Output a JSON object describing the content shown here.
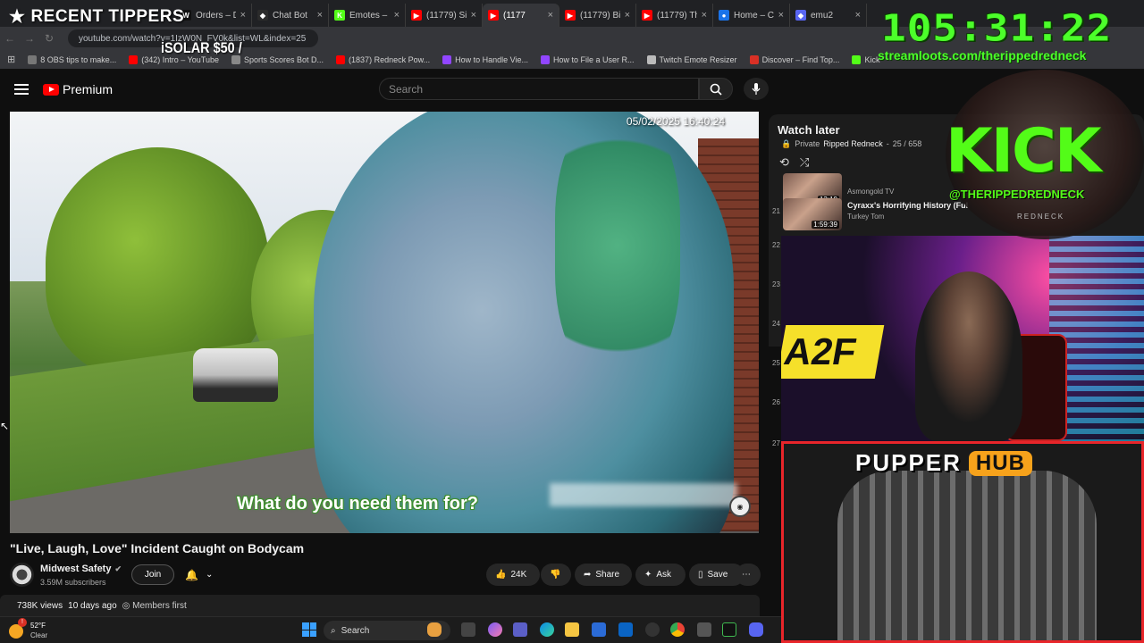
{
  "overlay": {
    "tippers_title": "RECENT TIPPERS",
    "tip_line": "iSOLAR $50 /",
    "timer": "105:31:22",
    "streamloots": "streamloots.com/therippedredneck",
    "kick_logo": "KICK",
    "kick_handle": "@THERIPPEDREDNECK",
    "kick_sub": "REDNECK",
    "pupper": "PUPPER",
    "hub": "HUB"
  },
  "browser": {
    "tabs": [
      {
        "label": "Orders – D",
        "color": "#111111",
        "glyph": "W"
      },
      {
        "label": "Chat Bot",
        "color": "#2b2b2b",
        "glyph": "◆"
      },
      {
        "label": "Emotes – ",
        "color": "#53fc18",
        "glyph": "K"
      },
      {
        "label": "(11779) Si",
        "color": "#ff0000",
        "glyph": "▶"
      },
      {
        "label": "(1177",
        "color": "#ff0000",
        "glyph": "▶"
      },
      {
        "label": "(11779) Bi",
        "color": "#ff0000",
        "glyph": "▶"
      },
      {
        "label": "(11779) Th",
        "color": "#ff0000",
        "glyph": "▶"
      },
      {
        "label": "Home – C",
        "color": "#1a73e8",
        "glyph": "●"
      },
      {
        "label": "emu2",
        "color": "#5865f2",
        "glyph": "◆"
      }
    ],
    "url": "youtube.com/watch?v=1IzW0N_FV0k&list=WL&index=25",
    "bookmarks": [
      {
        "label": "8 OBS tips to make...",
        "color": "#777777"
      },
      {
        "label": "(342) Intro – YouTube",
        "color": "#ff0000"
      },
      {
        "label": "Sports Scores Bot D...",
        "color": "#888888"
      },
      {
        "label": "(1837) Redneck Pow...",
        "color": "#ff0000"
      },
      {
        "label": "How to Handle Vie...",
        "color": "#9146ff"
      },
      {
        "label": "How to File a User R...",
        "color": "#9146ff"
      },
      {
        "label": "Twitch Emote Resizer",
        "color": "#bbbbbb"
      },
      {
        "label": "Discover – Find Top...",
        "color": "#d93025"
      },
      {
        "label": "Kick",
        "color": "#53fc18"
      }
    ]
  },
  "youtube": {
    "brand": "Premium",
    "search_placeholder": "Search",
    "video": {
      "timestamp": "05/02/2025 16:40:24",
      "subtitle": "What do you need them for?",
      "title": "\"Live, Laugh, Love\" Incident Caught on Bodycam"
    },
    "channel": {
      "name": "Midwest Safety",
      "subscribers": "3.59M subscribers",
      "join_label": "Join"
    },
    "actions": {
      "likes": "24K",
      "share": "Share",
      "ask": "Ask",
      "save": "Save"
    },
    "meta": {
      "views": "738K views",
      "age": "10 days ago",
      "members": "Members first"
    },
    "playlist": {
      "title": "Watch later",
      "privacy": "Private",
      "owner": "Ripped Redneck",
      "position": "25 / 658",
      "items": [
        {
          "index": "",
          "duration": "13:19",
          "title": "",
          "channel": "Asmongold TV"
        },
        {
          "index": "21",
          "duration": "1:59:39",
          "title": "Cyraxx's Horrifying History (Ful",
          "channel": "Turkey Tom"
        }
      ],
      "side_numbers": [
        "22",
        "23",
        "24",
        "25",
        "26",
        "27"
      ]
    }
  },
  "taskbar": {
    "temperature": "52°F",
    "condition": "Clear",
    "badge": "!",
    "search_label": "Search"
  }
}
